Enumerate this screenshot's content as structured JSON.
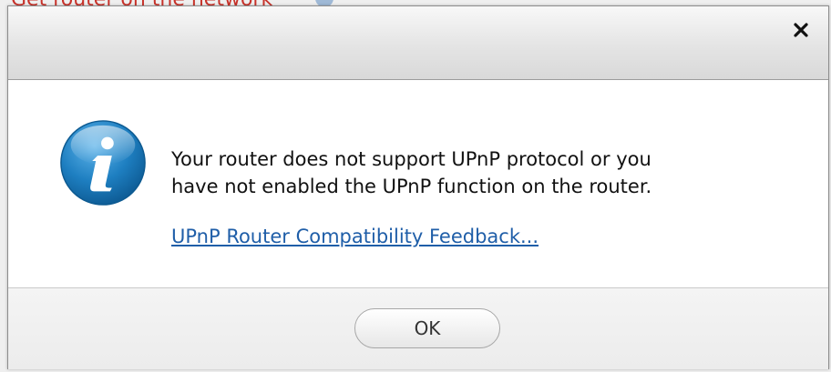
{
  "background": {
    "partial_text": "Get router on the network",
    "help_icon": "question-circle-icon"
  },
  "dialog": {
    "close_icon": "close-x-icon",
    "info_icon": "info-icon",
    "message_lines": [
      "Your router does not support UPnP protocol or you",
      "have not enabled the UPnP function on the router."
    ],
    "link_text": "UPnP Router Compatibility Feedback...",
    "ok_label": "OK"
  },
  "colors": {
    "link": "#1f5ea8",
    "info_icon_blue": "#1e7fc1",
    "background_text_red": "#c8322a"
  }
}
